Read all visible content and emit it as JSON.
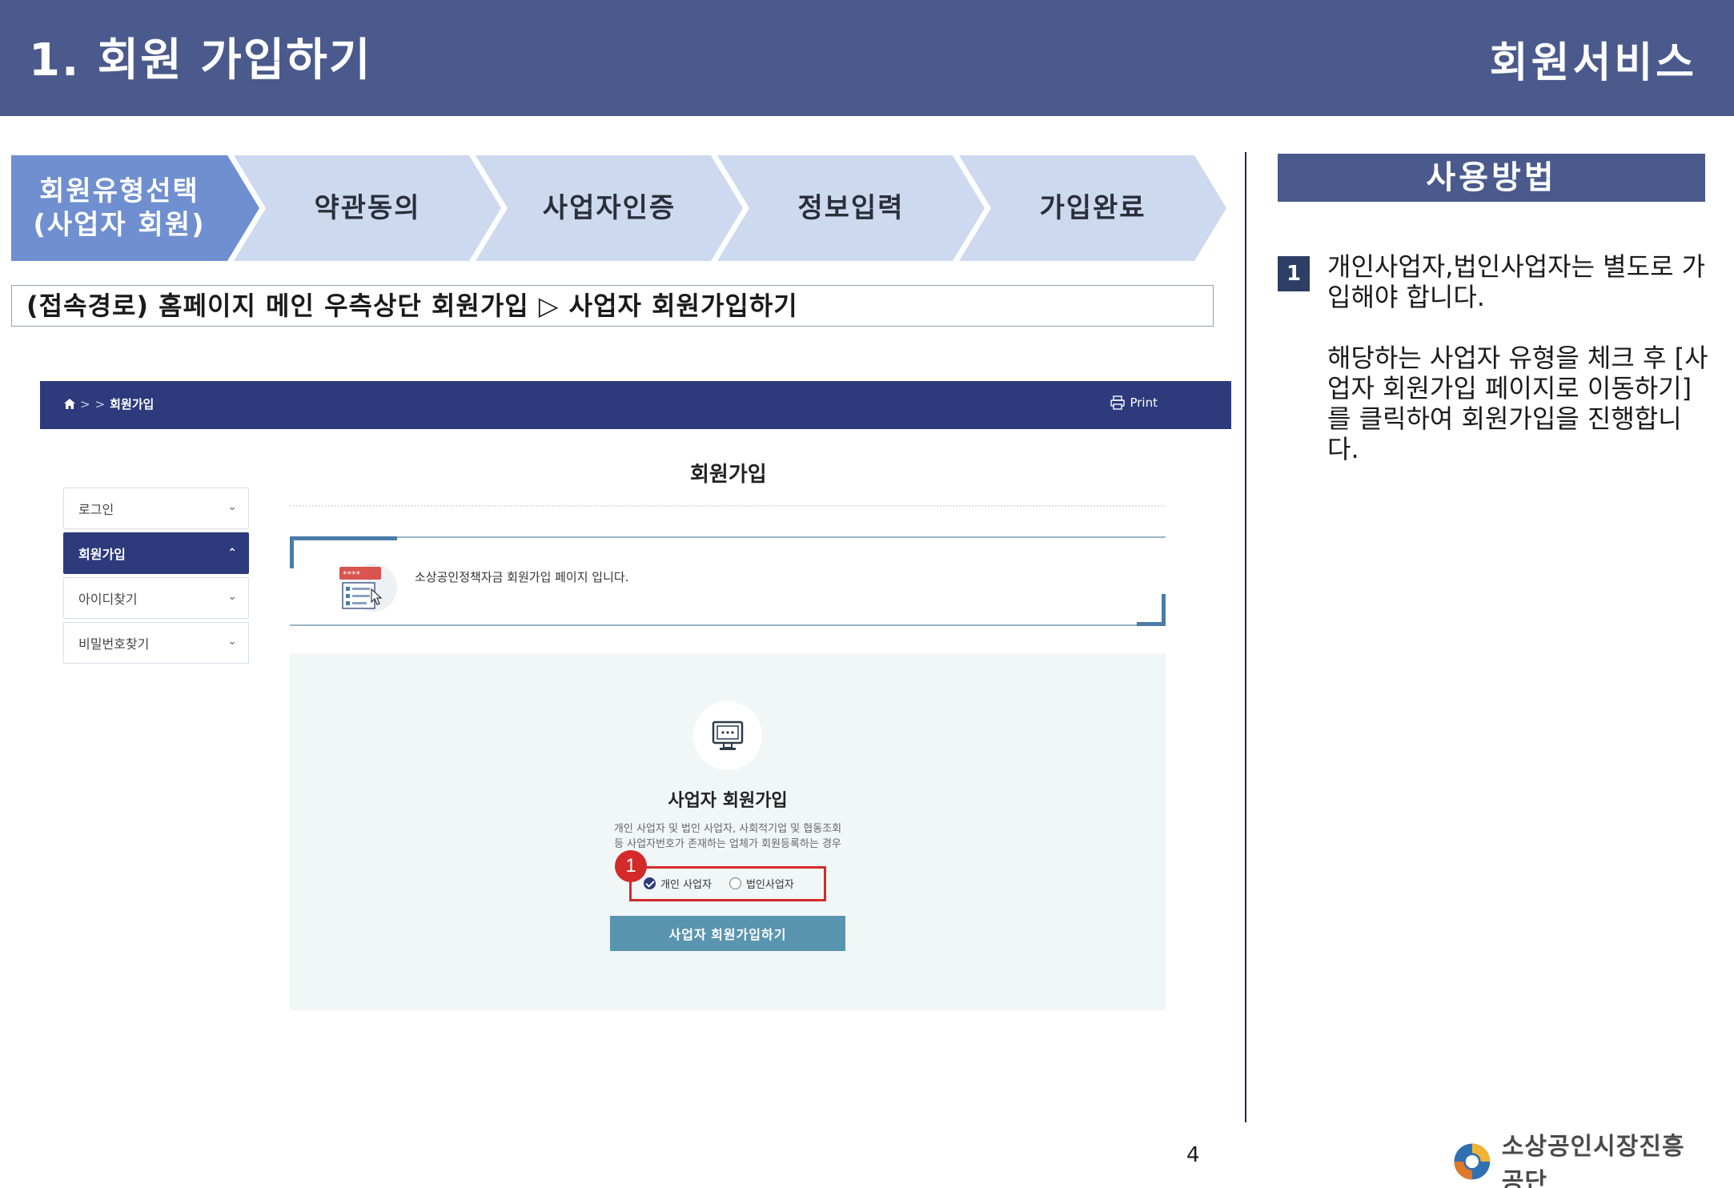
{
  "header": {
    "title": "1. 회원 가입하기",
    "section": "회원서비스"
  },
  "steps": [
    {
      "label_line1": "회원유형선택",
      "label_line2": "(사업자 회원)",
      "active": true
    },
    {
      "label_line1": "약관동의",
      "label_line2": "",
      "active": false
    },
    {
      "label_line1": "사업자인증",
      "label_line2": "",
      "active": false
    },
    {
      "label_line1": "정보입력",
      "label_line2": "",
      "active": false
    },
    {
      "label_line1": "가입완료",
      "label_line2": "",
      "active": false
    }
  ],
  "access_path": "(접속경로) 홈페이지 메인 우측상단 회원가입 ▷ 사업자 회원가입하기",
  "usage": {
    "title": "사용방법",
    "badge": "1",
    "paragraph1": "개인사업자,법인사업자는  별도로 가입해야 합니다.",
    "paragraph2": "해당하는 사업자 유형을 체크 후 [사업자 회원가입 페이지로 이동하기]를 클릭하여 회원가입을 진행합니다."
  },
  "footer": {
    "page_number": "4",
    "org_name": "소상공인시장진흥공단"
  },
  "screenshot": {
    "breadcrumb": {
      "home_icon": "home-icon",
      "sep1": ">",
      "sep2": ">",
      "current": "회원가입"
    },
    "print_label": "Print",
    "page_title": "회원가입",
    "sidebar": [
      {
        "label": "로그인",
        "expanded": false
      },
      {
        "label": "회원가입",
        "expanded": true
      },
      {
        "label": "아이디찾기",
        "expanded": false
      },
      {
        "label": "비밀번호찾기",
        "expanded": false
      }
    ],
    "intro_text": "소상공인정책자금 회원가입 페이지 입니다.",
    "signup": {
      "title": "사업자 회원가입",
      "desc_line1": "개인 사업자 및 법인 사업자, 사회적기업 및 협동조회",
      "desc_line2": "등 사업자번호가 존재하는 업체가 회원등록하는 경우",
      "option_individual": "개인 사업자",
      "option_corporate": "법인사업자",
      "selected": "individual",
      "button_label": "사업자 회원가입하기",
      "marker": "1"
    },
    "colors": {
      "nav_bar": "#2d3a7c",
      "button": "#5a95b0",
      "highlight": "#d42a2a"
    }
  }
}
